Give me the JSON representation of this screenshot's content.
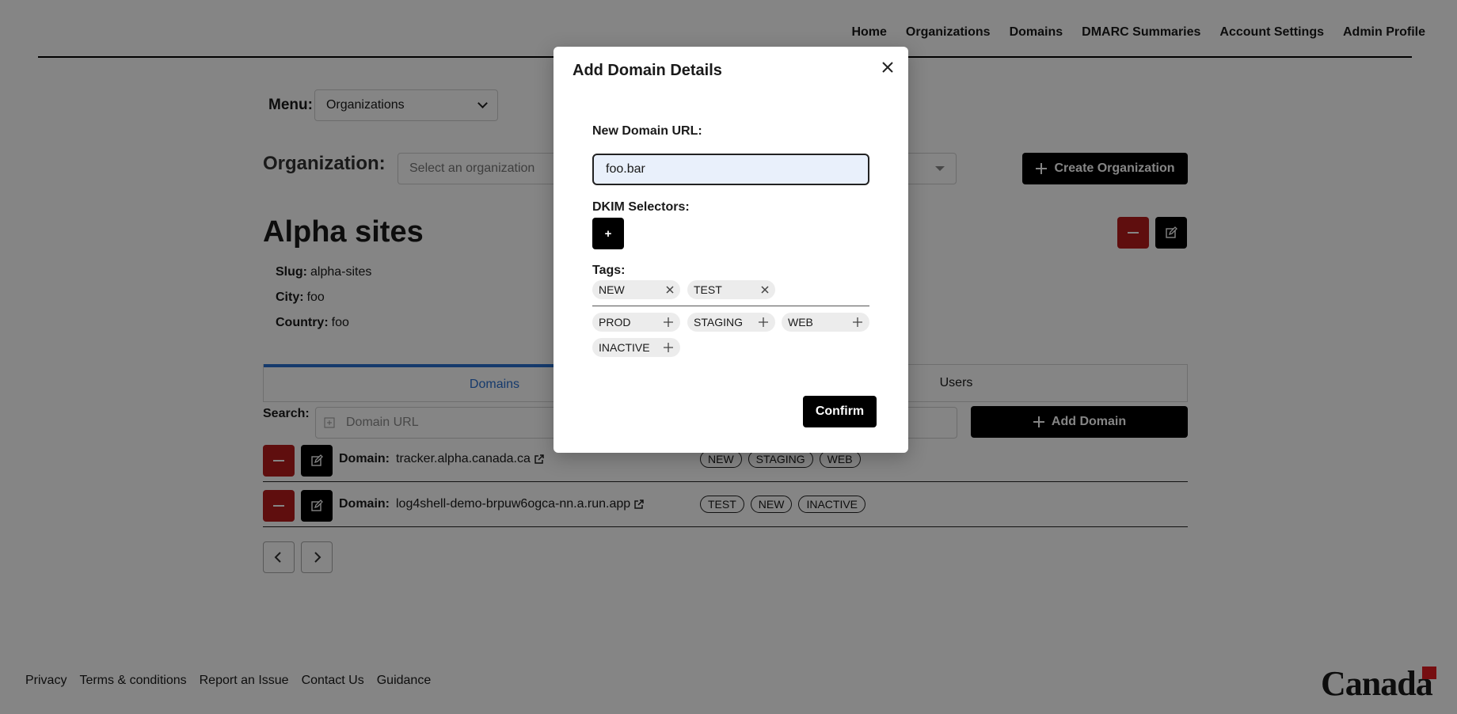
{
  "nav": {
    "items": [
      {
        "label": "Home"
      },
      {
        "label": "Organizations"
      },
      {
        "label": "Domains"
      },
      {
        "label": "DMARC Summaries"
      },
      {
        "label": "Account Settings"
      },
      {
        "label": "Admin Profile"
      }
    ]
  },
  "menu": {
    "label": "Menu:",
    "selected": "Organizations"
  },
  "organization": {
    "label": "Organization:",
    "placeholder": "Select an organization",
    "create_label": "Create Organization",
    "name": "Alpha sites",
    "slug_label": "Slug:",
    "slug": "alpha-sites",
    "city_label": "City:",
    "city": "foo",
    "country_label": "Country:",
    "country": "foo"
  },
  "tabs": [
    {
      "label": "Domains",
      "active": true
    },
    {
      "label": "Users",
      "active": false
    }
  ],
  "search": {
    "label": "Search:",
    "placeholder": "Domain URL",
    "add_label": "Add Domain"
  },
  "domains": [
    {
      "label": "Domain:",
      "url": "tracker.alpha.canada.ca",
      "tags": [
        "NEW",
        "STAGING",
        "WEB"
      ]
    },
    {
      "label": "Domain:",
      "url": "log4shell-demo-brpuw6ogca-nn.a.run.app",
      "tags": [
        "TEST",
        "NEW",
        "INACTIVE"
      ]
    }
  ],
  "footer": {
    "links": [
      {
        "label": "Privacy"
      },
      {
        "label": "Terms & conditions"
      },
      {
        "label": "Report an Issue"
      },
      {
        "label": "Contact Us"
      },
      {
        "label": "Guidance"
      }
    ],
    "wordmark": "Canada"
  },
  "modal": {
    "title": "Add Domain Details",
    "url_label": "New Domain URL:",
    "url_value": "foo.bar",
    "dkim_label": "DKIM Selectors:",
    "dkim_add": "+",
    "tags_label": "Tags:",
    "selected_tags": [
      "NEW",
      "TEST"
    ],
    "available_tags": [
      "PROD",
      "STAGING",
      "WEB",
      "INACTIVE"
    ],
    "confirm_label": "Confirm"
  },
  "colors": {
    "overlay": "#000000",
    "danger": "#b71c1c",
    "accent": "#2a6fcf"
  }
}
